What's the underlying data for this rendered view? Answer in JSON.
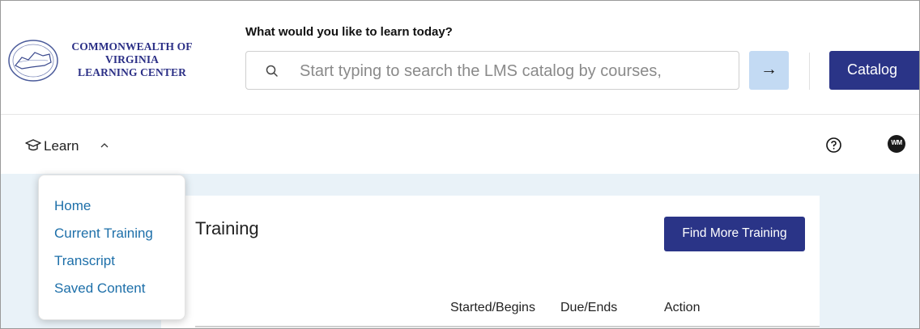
{
  "header": {
    "logo_lines": [
      "COMMONWEALTH OF",
      "VIRGINIA",
      "LEARNING CENTER"
    ],
    "prompt": "What would you like to learn today?",
    "search": {
      "placeholder": "Start typing to search the LMS catalog by courses,",
      "value": ""
    },
    "go_icon": "arrow-right-icon",
    "catalog_label": "Catalog"
  },
  "nav": {
    "learn_label": "Learn",
    "learn_icon": "graduation-cap-icon",
    "chevron_icon": "chevron-up-icon",
    "help_icon": "help-circle-icon",
    "avatar_initials": "WM"
  },
  "dropdown": {
    "items": [
      "Home",
      "Current Training",
      "Transcript",
      "Saved Content"
    ]
  },
  "main": {
    "title_visible": "Training",
    "find_button": "Find More Training",
    "columns": [
      "Started/Begins",
      "Due/Ends",
      "Action"
    ]
  },
  "colors": {
    "brand": "#2a3487",
    "link": "#1d6fa9",
    "go_button": "#c3daf3",
    "content_bg": "#e9f2f8"
  }
}
